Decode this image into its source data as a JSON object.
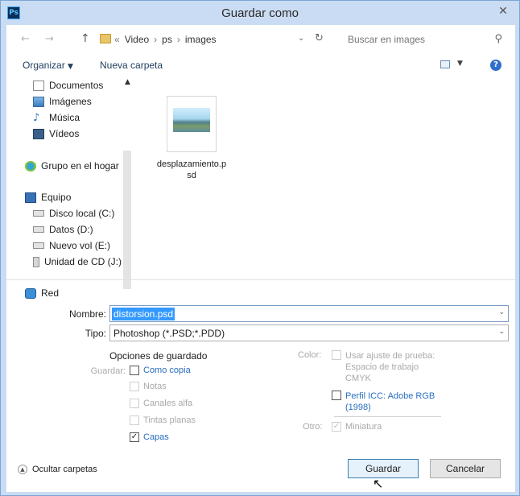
{
  "window": {
    "app_icon": "Ps",
    "title": "Guardar como",
    "close_glyph": "✕"
  },
  "address": {
    "crumbs_prefix": "«",
    "crumbs": [
      "Video",
      "ps",
      "images"
    ],
    "search_placeholder": "Buscar en images"
  },
  "toolbar": {
    "organize_label": "Organizar",
    "new_folder_label": "Nueva carpeta"
  },
  "nav": {
    "items": [
      {
        "label": "Documentos",
        "icon": "documents-icon"
      },
      {
        "label": "Imágenes",
        "icon": "pictures-icon"
      },
      {
        "label": "Música",
        "icon": "music-icon"
      },
      {
        "label": "Vídeos",
        "icon": "videos-icon"
      },
      {
        "label": "Grupo en el hogar",
        "icon": "homegroup-icon"
      },
      {
        "label": "Equipo",
        "icon": "computer-icon"
      },
      {
        "label": "Disco local (C:)",
        "icon": "local-disk-icon"
      },
      {
        "label": "Datos (D:)",
        "icon": "drive-icon"
      },
      {
        "label": "Nuevo vol (E:)",
        "icon": "drive-icon"
      },
      {
        "label": "Unidad de CD (J:)",
        "icon": "cd-drive-icon"
      },
      {
        "label": "Red",
        "icon": "network-icon"
      }
    ]
  },
  "files": [
    {
      "name": "desplazamiento.p\nsd"
    }
  ],
  "form": {
    "name_label": "Nombre:",
    "name_value": "distorsion.psd",
    "type_label": "Tipo:",
    "type_value": "Photoshop (*.PSD;*.PDD)"
  },
  "options": {
    "title": "Opciones de guardado",
    "save_label": "Guardar:",
    "as_copy": "Como copia",
    "notes": "Notas",
    "alpha": "Canales alfa",
    "spot": "Tintas planas",
    "layers": "Capas",
    "color_label": "Color:",
    "proof_line1": "Usar ajuste de prueba:",
    "proof_line2": "Espacio de trabajo",
    "proof_line3": "CMYK",
    "icc_line1": "Perfil ICC: Adobe RGB",
    "icc_line2": "(1998)",
    "other_label": "Otro:",
    "thumbnail": "Miniatura",
    "layers_checked": true,
    "thumbnail_checked": true
  },
  "footer": {
    "hide_folders": "Ocultar carpetas",
    "save_button": "Guardar",
    "cancel_button": "Cancelar"
  }
}
